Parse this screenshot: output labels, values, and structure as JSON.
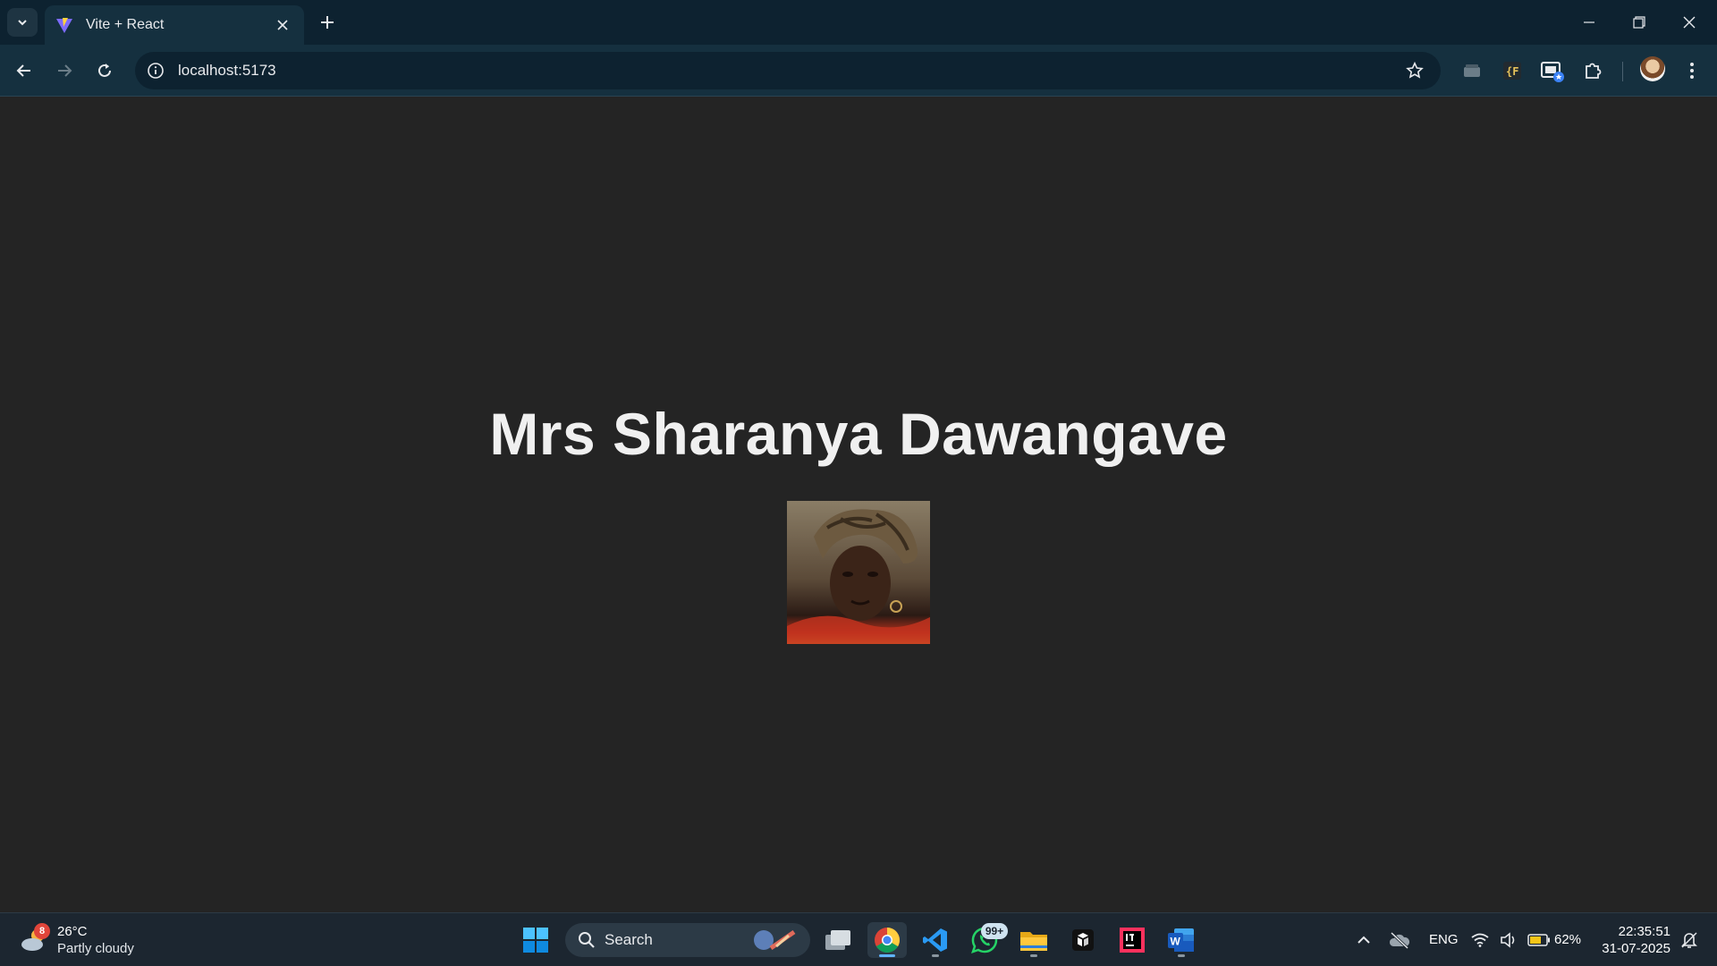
{
  "browser": {
    "tab": {
      "title": "Vite + React"
    },
    "address_bar": {
      "url": "localhost:5173"
    }
  },
  "page": {
    "heading": "Mrs Sharanya Dawangave"
  },
  "taskbar": {
    "weather": {
      "temperature": "26°C",
      "condition": "Partly cloudy",
      "badge": "8"
    },
    "search": {
      "label": "Search"
    },
    "whatsapp_badge": "99+",
    "tray": {
      "language": "ENG",
      "battery": "62%",
      "time": "22:35:51",
      "date": "31-07-2025"
    }
  },
  "colors": {
    "page_background": "#242424",
    "browser_chrome": "#15303f",
    "taskbar": "#1c2630"
  }
}
